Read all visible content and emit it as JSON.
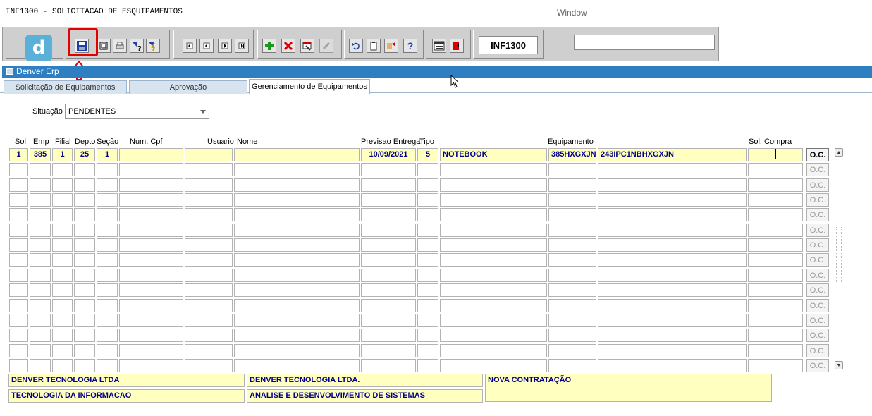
{
  "menubar": {
    "title": "INF1300 - SOLICITACAO DE ESQUIPAMENTOS",
    "window_menu": "Window"
  },
  "toolbar": {
    "form_code": "INF1300",
    "help_label": "?",
    "search_value": ""
  },
  "window": {
    "title": "Denver Erp"
  },
  "tabs": [
    {
      "label": "Solicitação de Equipamentos"
    },
    {
      "label": "Aprovação"
    },
    {
      "label": "Gerenciamento de Equipamentos"
    }
  ],
  "filter": {
    "label": "Situação",
    "value": "PENDENTES"
  },
  "columns": {
    "sol": "Sol",
    "emp": "Emp",
    "filial": "Filial",
    "depto": "Depto",
    "secao": "Seção",
    "numcpf": "Num. Cpf",
    "usuario": "Usuario",
    "nome": "Nome",
    "previsao": "Previsao Entrega",
    "tipo": "Tipo",
    "equipamento": "Equipamento",
    "solcompra": "Sol. Compra"
  },
  "rows": [
    {
      "sol": "1",
      "emp": "385",
      "filial": "1",
      "depto": "25",
      "secao": "1",
      "numcpf": "",
      "usuario": "",
      "nome": "",
      "previsao": "10/09/2021",
      "tipo": "5",
      "tipo_desc": "NOTEBOOK",
      "equip_code": "385HXGXJN",
      "equip_desc": "243IPC1NBHXGXJN",
      "solcompra": ""
    }
  ],
  "oc_label": "O.C.",
  "empty_rows": 14,
  "footer": {
    "empresa": "DENVER TECNOLOGIA LTDA",
    "filial": "DENVER TECNOLOGIA LTDA.",
    "motivo": "NOVA CONTRATAÇÃO",
    "departamento": "TECNOLOGIA DA INFORMACAO",
    "secao": "ANALISE E DESENVOLVIMENTO DE SISTEMAS"
  }
}
